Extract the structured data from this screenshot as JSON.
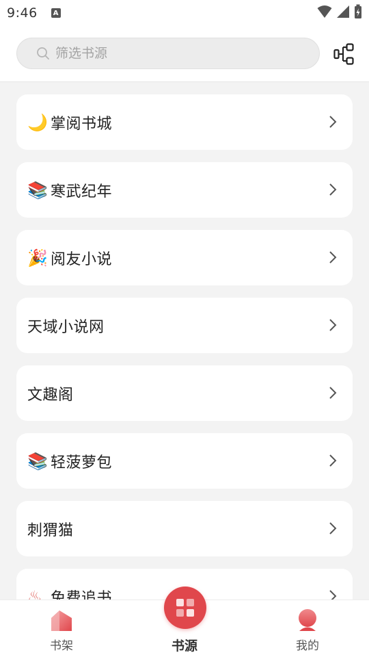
{
  "status_bar": {
    "time": "9:46",
    "notification_icon": "a-icon"
  },
  "search": {
    "placeholder": "筛选书源"
  },
  "header": {
    "manage_icon": "source-manage-icon"
  },
  "sources": [
    {
      "emoji": "🌙",
      "label": "掌阅书城"
    },
    {
      "emoji": "📚",
      "label": "寒武纪年"
    },
    {
      "emoji": "🎉",
      "label": "阅友小说"
    },
    {
      "emoji": "",
      "label": "天域小说网"
    },
    {
      "emoji": "",
      "label": "文趣阁"
    },
    {
      "emoji": "📚",
      "label": "轻菠萝包"
    },
    {
      "emoji": "",
      "label": "刺猬猫"
    },
    {
      "emoji": "♨",
      "label": "免费追书"
    }
  ],
  "bottom_nav": {
    "items": [
      {
        "label": "书架",
        "icon": "bookshelf-icon"
      },
      {
        "label": "书源",
        "icon": "book-source-icon",
        "active": true
      },
      {
        "label": "我的",
        "icon": "profile-icon"
      }
    ]
  },
  "colors": {
    "accent": "#e0474c",
    "background": "#f3f3f3",
    "card": "#ffffff"
  }
}
